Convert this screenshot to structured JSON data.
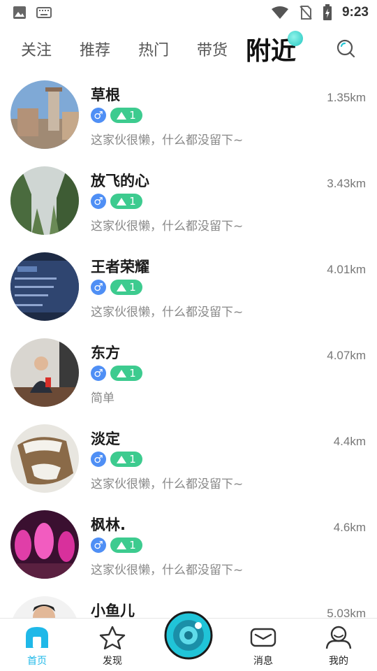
{
  "status_bar": {
    "time": "9:23"
  },
  "tabs": [
    {
      "label": "关注"
    },
    {
      "label": "推荐"
    },
    {
      "label": "热门"
    },
    {
      "label": "带货"
    },
    {
      "label": "附近",
      "active": true
    }
  ],
  "users": [
    {
      "name": "草根",
      "gender": "♂",
      "level": "1",
      "bio": "这家伙很懒，什么都没留下~",
      "distance": "1.35km"
    },
    {
      "name": "放飞的心",
      "gender": "♂",
      "level": "1",
      "bio": "这家伙很懒，什么都没留下~",
      "distance": "3.43km"
    },
    {
      "name": "王者荣耀",
      "gender": "♂",
      "level": "1",
      "bio": "这家伙很懒，什么都没留下~",
      "distance": "4.01km"
    },
    {
      "name": "东方",
      "gender": "♂",
      "level": "1",
      "bio": "简单",
      "distance": "4.07km"
    },
    {
      "name": "淡定",
      "gender": "♂",
      "level": "1",
      "bio": "这家伙很懒，什么都没留下~",
      "distance": "4.4km"
    },
    {
      "name": "枫林.",
      "gender": "♂",
      "level": "1",
      "bio": "这家伙很懒，什么都没留下~",
      "distance": "4.6km"
    },
    {
      "name": "小鱼儿",
      "gender": "",
      "level": "",
      "bio": "",
      "distance": "5.03km"
    }
  ],
  "bottom_nav": [
    {
      "label": "首页",
      "icon": "home-icon",
      "active": true
    },
    {
      "label": "发现",
      "icon": "star-icon"
    },
    {
      "label": "消息",
      "icon": "mail-icon"
    },
    {
      "label": "我的",
      "icon": "profile-icon"
    }
  ],
  "colors": {
    "accent": "#1fb8e8",
    "level_badge": "#3dcb8f",
    "gender_badge": "#4f8ff5",
    "camera": "#20c4d8"
  }
}
